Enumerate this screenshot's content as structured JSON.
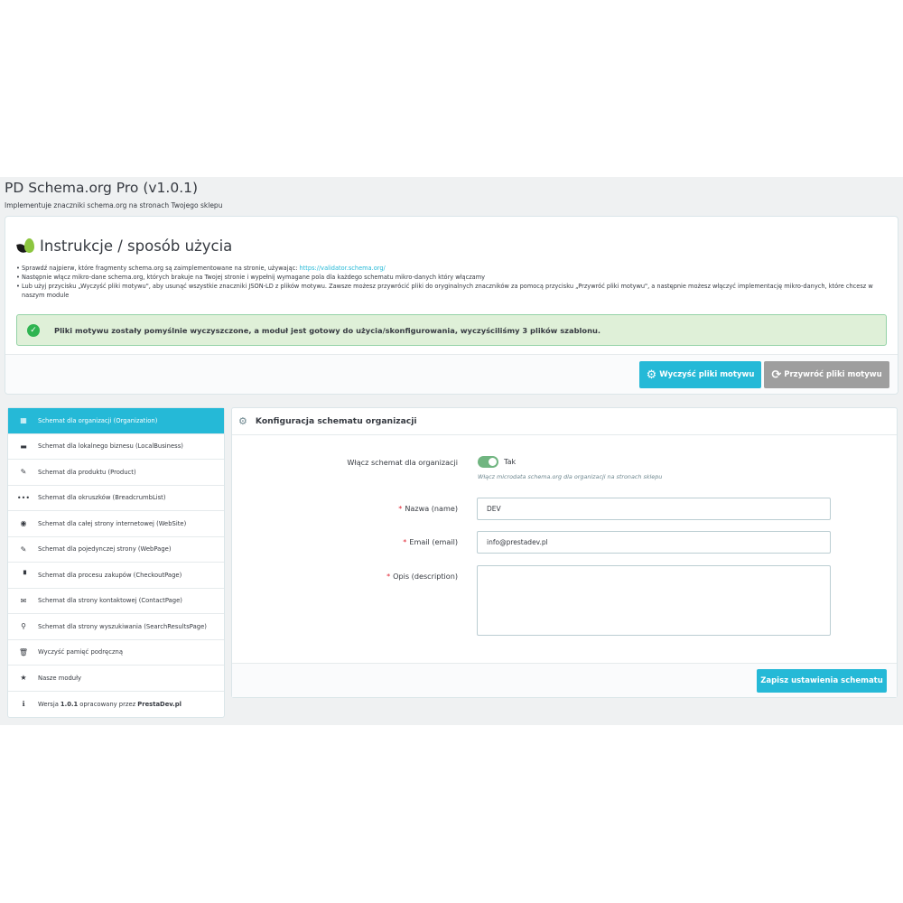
{
  "header": {
    "title": "PD Schema.org Pro (v1.0.1)",
    "subtitle": "Implementuje znaczniki schema.org na stronach Twojego sklepu"
  },
  "instructions": {
    "title": "Instrukcje / sposób użycia",
    "items": [
      {
        "text": "Sprawdź najpierw, które fragmenty schema.org są zaimplementowane na stronie, używając: ",
        "link": "https://validator.schema.org/"
      },
      {
        "text": "Następnie włącz mikro-dane schema.org, których brakuje na Twojej stronie i wypełnij wymagane pola dla każdego schematu mikro-danych który włączamy",
        "link": ""
      },
      {
        "text": "Lub użyj przycisku „Wyczyść pliki motywu\", aby usunąć wszystkie znaczniki JSON-LD z plików motywu. Zawsze możesz przywrócić pliki do oryginalnych znaczników za pomocą przycisku „Przywróć pliki motywu\", a następnie możesz włączyć implementację mikro-danych, które chcesz w naszym module",
        "link": ""
      }
    ],
    "alert": "Pliki motywu zostały pomyślnie wyczyszczone, a moduł jest gotowy do użycia/skonfigurowania, wyczyściliśmy 3 plików szablonu.",
    "clear_button": "Wyczyść pliki motywu",
    "restore_button": "Przywróć pliki motywu"
  },
  "sidebar": {
    "items": [
      {
        "label": "Schemat dla organizacji (Organization)",
        "icon": "building-icon",
        "glyph": "▦"
      },
      {
        "label": "Schemat dla lokalnego biznesu (LocalBusiness)",
        "icon": "briefcase-icon",
        "glyph": "▬"
      },
      {
        "label": "Schemat dla produktu (Product)",
        "icon": "pencil-icon",
        "glyph": "✎"
      },
      {
        "label": "Schemat dla okruszków (BreadcrumbList)",
        "icon": "ellipsis-icon",
        "glyph": "•••"
      },
      {
        "label": "Schemat dla całej strony internetowej (WebSite)",
        "icon": "globe-icon",
        "glyph": "◉"
      },
      {
        "label": "Schemat dla pojedynczej strony (WebPage)",
        "icon": "pencil-icon",
        "glyph": "✎"
      },
      {
        "label": "Schemat dla procesu zakupów (CheckoutPage)",
        "icon": "cart-icon",
        "glyph": "▝"
      },
      {
        "label": "Schemat dla strony kontaktowej (ContactPage)",
        "icon": "envelope-icon",
        "glyph": "✉"
      },
      {
        "label": "Schemat dla strony wyszukiwania (SearchResultsPage)",
        "icon": "search-icon",
        "glyph": "⚲"
      },
      {
        "label": "Wyczyść pamięć podręczną",
        "icon": "trash-icon",
        "glyph": "🗑"
      },
      {
        "label": "Nasze moduły",
        "icon": "star-icon",
        "glyph": "★"
      }
    ],
    "version": {
      "prefix": "Wersja",
      "number": "1.0.1",
      "middle": "opracowany przez",
      "author": "PrestaDev.pl",
      "icon": "info-icon"
    }
  },
  "config": {
    "title": "Konfiguracja schematu organizacji",
    "enable_label": "Włącz schemat dla organizacji",
    "enable_value": "Tak",
    "enable_help": "Włącz microdata schema.org dla organizacji na stronach sklepu",
    "name_label": "Nazwa (name)",
    "name_value": "DEV",
    "email_label": "Email (email)",
    "email_value": "info@prestadev.pl",
    "description_label": "Opis (description)",
    "description_value": "",
    "required_mark": "*",
    "save_button": "Zapisz ustawienia schematu"
  },
  "colors": {
    "primary": "#25b9d7",
    "success_bg": "#dff0d8",
    "switch_on": "#70b580",
    "secondary_button": "#9e9e9e"
  }
}
